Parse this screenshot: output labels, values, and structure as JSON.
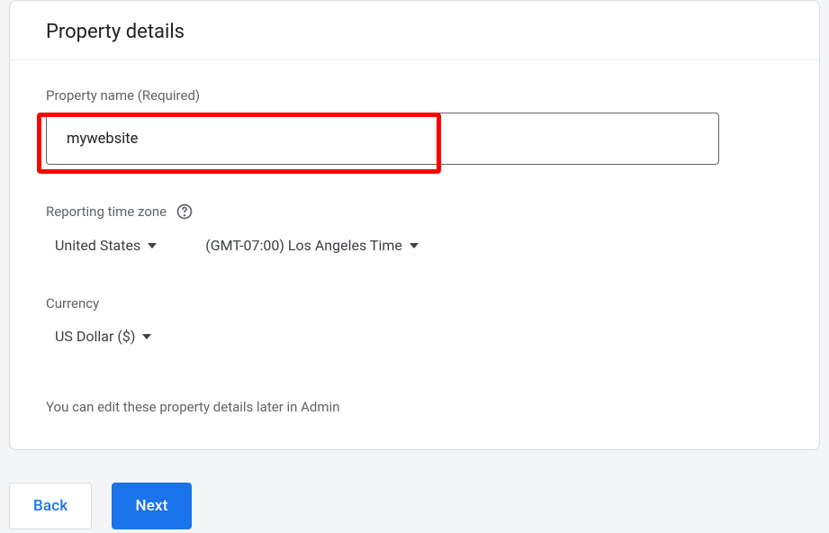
{
  "header": {
    "title": "Property details"
  },
  "propertyName": {
    "label": "Property name (Required)",
    "value": "mywebsite"
  },
  "timezone": {
    "label": "Reporting time zone",
    "country": "United States",
    "zone": "(GMT-07:00) Los Angeles Time"
  },
  "currency": {
    "label": "Currency",
    "value": "US Dollar ($)"
  },
  "hint": "You can edit these property details later in Admin",
  "buttons": {
    "back": "Back",
    "next": "Next"
  }
}
